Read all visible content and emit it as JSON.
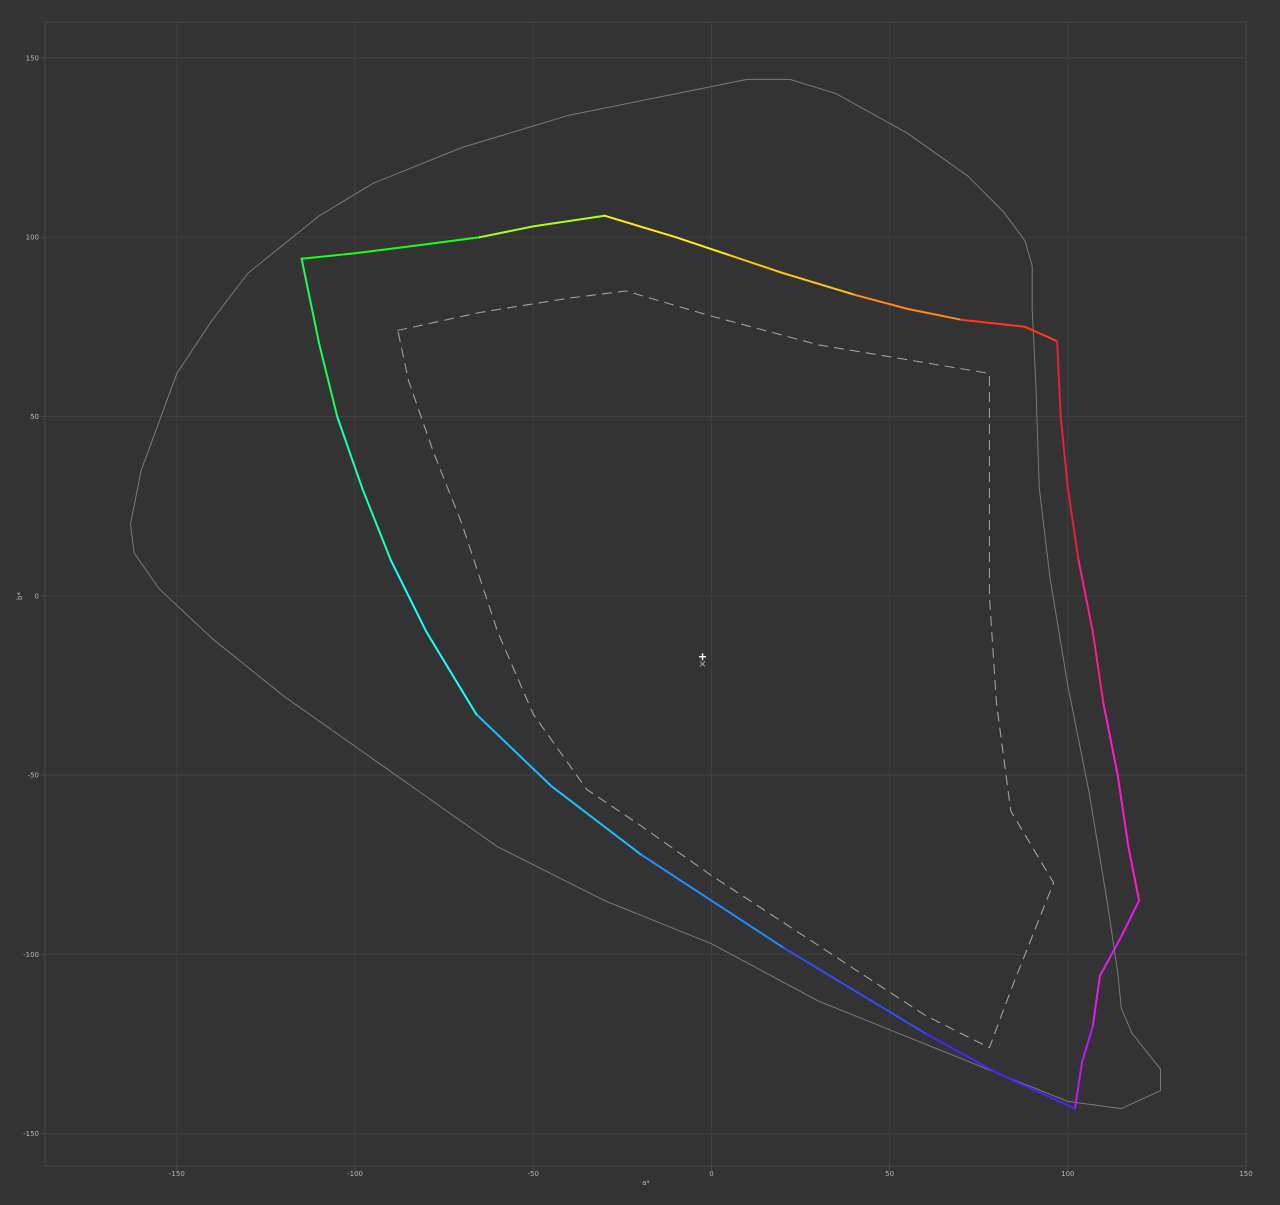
{
  "chart_data": {
    "type": "line",
    "title": "",
    "xlabel": "a*",
    "ylabel": "b*",
    "xlim": [
      -187,
      150
    ],
    "ylim": [
      -159,
      160
    ],
    "grid": true,
    "xticks": [
      -150,
      -100,
      -50,
      0,
      50,
      100,
      150
    ],
    "yticks": [
      -150,
      -100,
      -50,
      0,
      50,
      100,
      150
    ],
    "colors": {
      "background": "#333333",
      "grid": "#444444",
      "axis": "#555555",
      "reference": "#7a7a7a",
      "inner": "#a0a0a0",
      "marker": "#ffffff"
    },
    "series": [
      {
        "role": "reference-gamut",
        "style": "solid",
        "points": [
          [
            -163,
            20
          ],
          [
            -160,
            35
          ],
          [
            -150,
            62
          ],
          [
            -140,
            77
          ],
          [
            -130,
            90
          ],
          [
            -110,
            106
          ],
          [
            -95,
            115
          ],
          [
            -70,
            125
          ],
          [
            -40,
            134
          ],
          [
            -10,
            140
          ],
          [
            10,
            144
          ],
          [
            22,
            144
          ],
          [
            35,
            140
          ],
          [
            55,
            129
          ],
          [
            72,
            117
          ],
          [
            82,
            107
          ],
          [
            88,
            99
          ],
          [
            90,
            92
          ],
          [
            90,
            80
          ],
          [
            91,
            60
          ],
          [
            92,
            30
          ],
          [
            95,
            5
          ],
          [
            100,
            -25
          ],
          [
            106,
            -55
          ],
          [
            111,
            -85
          ],
          [
            114,
            -105
          ],
          [
            115,
            -115
          ],
          [
            118,
            -122
          ],
          [
            122,
            -127
          ],
          [
            126,
            -132
          ],
          [
            126,
            -138
          ],
          [
            115,
            -143
          ],
          [
            100,
            -141
          ],
          [
            80,
            -133
          ],
          [
            60,
            -125
          ],
          [
            30,
            -113
          ],
          [
            0,
            -97
          ],
          [
            -30,
            -85
          ],
          [
            -60,
            -70
          ],
          [
            -80,
            -56
          ],
          [
            -100,
            -42
          ],
          [
            -120,
            -28
          ],
          [
            -140,
            -12
          ],
          [
            -155,
            2
          ],
          [
            -162,
            12
          ],
          [
            -163,
            20
          ]
        ]
      },
      {
        "role": "inner-gamut",
        "style": "dashed",
        "points": [
          [
            -88,
            74
          ],
          [
            -65,
            79
          ],
          [
            -40,
            83
          ],
          [
            -24,
            85
          ],
          [
            0,
            78
          ],
          [
            30,
            70
          ],
          [
            60,
            65
          ],
          [
            78,
            62
          ],
          [
            78,
            30
          ],
          [
            78,
            0
          ],
          [
            80,
            -30
          ],
          [
            84,
            -60
          ],
          [
            96,
            -80
          ],
          [
            90,
            -95
          ],
          [
            84,
            -110
          ],
          [
            78,
            -126
          ],
          [
            60,
            -117
          ],
          [
            40,
            -104
          ],
          [
            20,
            -91
          ],
          [
            0,
            -78
          ],
          [
            -20,
            -64
          ],
          [
            -35,
            -54
          ],
          [
            -50,
            -33
          ],
          [
            -60,
            -10
          ],
          [
            -70,
            20
          ],
          [
            -78,
            40
          ],
          [
            -85,
            60
          ],
          [
            -88,
            74
          ]
        ]
      }
    ],
    "main_gamut": {
      "role": "primary-gamut",
      "segments": [
        {
          "color": "#1aff1a",
          "points": [
            [
              -115,
              94
            ],
            [
              -100,
              95.5
            ],
            [
              -80,
              98
            ],
            [
              -65,
              100
            ]
          ]
        },
        {
          "color": "#aaff22",
          "points": [
            [
              -65,
              100
            ],
            [
              -50,
              103
            ],
            [
              -30,
              106
            ]
          ]
        },
        {
          "color": "#ffea22",
          "points": [
            [
              -30,
              106
            ],
            [
              -10,
              100
            ],
            [
              5,
              95
            ]
          ]
        },
        {
          "color": "#ffc41a",
          "points": [
            [
              5,
              95
            ],
            [
              20,
              90
            ],
            [
              40,
              84
            ]
          ]
        },
        {
          "color": "#ff8a1a",
          "points": [
            [
              40,
              84
            ],
            [
              55,
              80
            ],
            [
              70,
              77
            ]
          ]
        },
        {
          "color": "#ff3a1a",
          "points": [
            [
              70,
              77
            ],
            [
              88,
              75
            ],
            [
              97,
              71
            ]
          ]
        },
        {
          "color": "#e6203a",
          "points": [
            [
              97,
              71
            ],
            [
              98,
              50
            ],
            [
              100,
              30
            ],
            [
              103,
              10
            ]
          ]
        },
        {
          "color": "#ff1a90",
          "points": [
            [
              103,
              10
            ],
            [
              107,
              -10
            ],
            [
              110,
              -30
            ]
          ]
        },
        {
          "color": "#ff1ad0",
          "points": [
            [
              110,
              -30
            ],
            [
              114,
              -50
            ],
            [
              117,
              -70
            ],
            [
              120,
              -85
            ]
          ]
        },
        {
          "color": "#e61af0",
          "points": [
            [
              120,
              -85
            ],
            [
              115,
              -95
            ],
            [
              109,
              -106
            ],
            [
              107,
              -120
            ]
          ]
        },
        {
          "color": "#b81aff",
          "points": [
            [
              107,
              -120
            ],
            [
              104,
              -130
            ],
            [
              102,
              -143
            ]
          ]
        },
        {
          "color": "#4426ff",
          "points": [
            [
              102,
              -143
            ],
            [
              80,
              -133
            ],
            [
              60,
              -122
            ]
          ]
        },
        {
          "color": "#2a50ff",
          "points": [
            [
              60,
              -122
            ],
            [
              40,
              -110
            ],
            [
              20,
              -98
            ]
          ]
        },
        {
          "color": "#1a90ff",
          "points": [
            [
              20,
              -98
            ],
            [
              0,
              -85
            ],
            [
              -20,
              -72
            ]
          ]
        },
        {
          "color": "#1ac0ff",
          "points": [
            [
              -20,
              -72
            ],
            [
              -45,
              -53
            ],
            [
              -66,
              -33
            ]
          ]
        },
        {
          "color": "#1affff",
          "points": [
            [
              -66,
              -33
            ],
            [
              -80,
              -10
            ],
            [
              -90,
              10
            ]
          ]
        },
        {
          "color": "#1affb0",
          "points": [
            [
              -90,
              10
            ],
            [
              -98,
              30
            ],
            [
              -105,
              50
            ]
          ]
        },
        {
          "color": "#1aff50",
          "points": [
            [
              -105,
              50
            ],
            [
              -110,
              70
            ],
            [
              -115,
              94
            ]
          ]
        }
      ]
    },
    "markers": [
      {
        "shape": "plus",
        "a": -2.5,
        "b": -17
      },
      {
        "shape": "cross",
        "a": -2.5,
        "b": -19
      }
    ]
  }
}
